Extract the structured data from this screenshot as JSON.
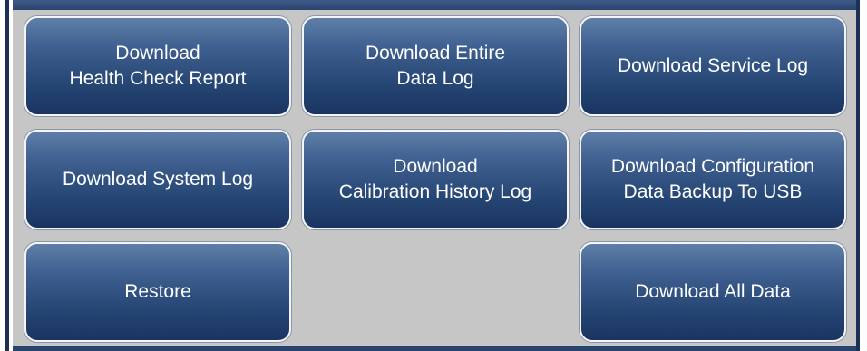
{
  "buttons": {
    "health_check": {
      "line1": "Download",
      "line2": "Health Check Report"
    },
    "entire_data_log": {
      "line1": "Download Entire",
      "line2": "Data Log"
    },
    "service_log": {
      "line1": "Download Service Log"
    },
    "system_log": {
      "line1": "Download System Log"
    },
    "calibration_history": {
      "line1": "Download",
      "line2": "Calibration History Log"
    },
    "config_backup": {
      "line1": "Download Configuration",
      "line2": "Data Backup To USB"
    },
    "restore": {
      "line1": "Restore"
    },
    "all_data": {
      "line1": "Download All Data"
    }
  },
  "colors": {
    "panel_background": "#c6c6c6",
    "button_top": "#5f7fa7",
    "button_bottom": "#1a3461",
    "button_text": "#ffffff",
    "frame": "#2a4470"
  }
}
